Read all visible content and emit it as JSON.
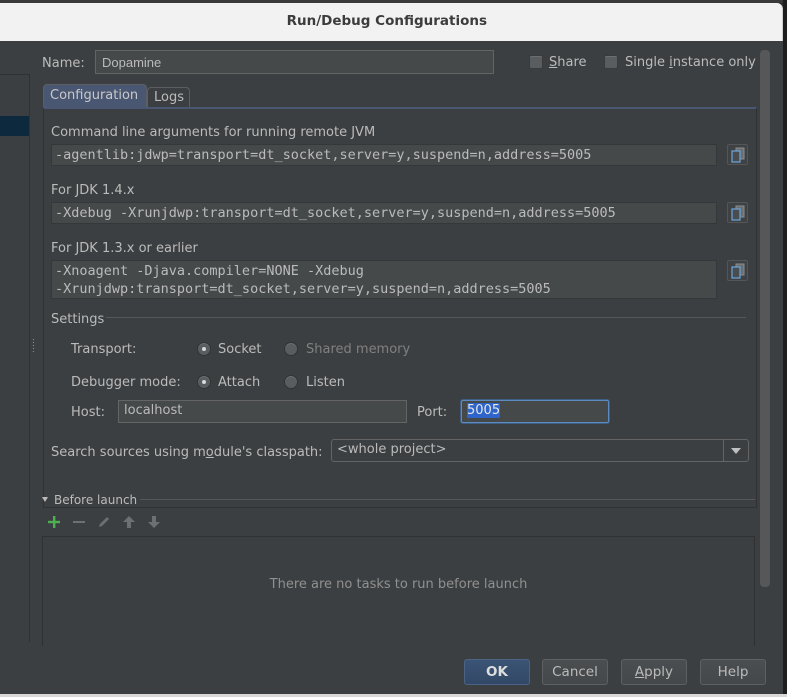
{
  "window": {
    "title": "Run/Debug Configurations"
  },
  "header": {
    "name_label": "Name:",
    "name_value": "Dopamine",
    "share_label_prefix": "",
    "share_label_mnemonic": "S",
    "share_label_rest": "hare",
    "share_checked": false,
    "single_instance_prefix": "Single ",
    "single_instance_mnemonic": "i",
    "single_instance_rest": "nstance only",
    "single_instance_checked": false
  },
  "tabs": [
    {
      "label": "Configuration",
      "active": true
    },
    {
      "label": "Logs",
      "active": false
    }
  ],
  "configuration": {
    "cmd_label": "Command line arguments for running remote JVM",
    "cmd_value": "-agentlib:jdwp=transport=dt_socket,server=y,suspend=n,address=5005",
    "jdk14_label": "For JDK 1.4.x",
    "jdk14_value": "-Xdebug -Xrunjdwp:transport=dt_socket,server=y,suspend=n,address=5005",
    "jdk13_label": "For JDK 1.3.x or earlier",
    "jdk13_value_line1": "-Xnoagent -Djava.compiler=NONE -Xdebug",
    "jdk13_value_line2": "-Xrunjdwp:transport=dt_socket,server=y,suspend=n,address=5005",
    "copy_icon": "copy-icon"
  },
  "settings": {
    "title": "Settings",
    "transport_label": "Transport:",
    "transport_options": [
      {
        "label": "Socket",
        "selected": true,
        "enabled": true
      },
      {
        "label": "Shared memory",
        "selected": false,
        "enabled": false
      }
    ],
    "mode_label": "Debugger mode:",
    "mode_options": [
      {
        "label": "Attach",
        "selected": true,
        "enabled": true
      },
      {
        "label": "Listen",
        "selected": false,
        "enabled": true
      }
    ],
    "host_label": "Host:",
    "host_value": "localhost",
    "port_label": "Port:",
    "port_value": "5005",
    "classpath_label_prefix": "Search sources using m",
    "classpath_label_mnemonic": "o",
    "classpath_label_rest": "dule's classpath:",
    "classpath_value": "<whole project>"
  },
  "before_launch": {
    "title": "Before launch",
    "toolbar": [
      "add-icon",
      "remove-icon",
      "edit-icon",
      "move-up-icon",
      "move-down-icon"
    ],
    "empty_text": "There are no tasks to run before launch"
  },
  "buttons": {
    "ok": "OK",
    "cancel": "Cancel",
    "apply_mnemonic": "A",
    "apply_rest": "pply",
    "help": "Help"
  },
  "colors": {
    "background": "#3c3f41",
    "accent_tab": "#4a5772",
    "selection": "#2f65ca",
    "add_green": "#4caf50"
  }
}
